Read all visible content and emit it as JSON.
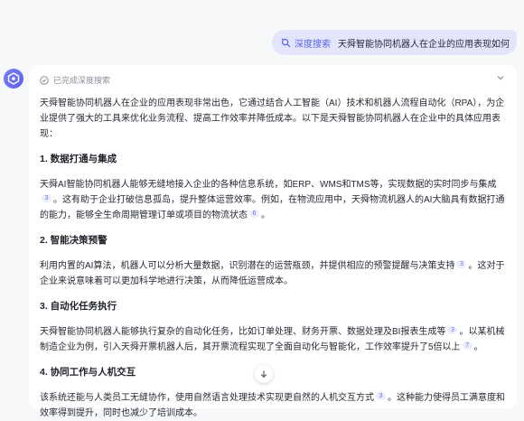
{
  "user_message": {
    "tag_label": "深度搜索",
    "tag_icon": "deep-search-icon",
    "text": "天舜智能协同机器人在企业的应用表现如何"
  },
  "assistant": {
    "status_label": "已完成深度搜索",
    "intro": "天舜智能协同机器人在企业的应用表现非常出色，它通过结合人工智能（AI）技术和机器人流程自动化（RPA），为企业提供了强大的工具来优化业务流程、提高工作效率并降低成本。以下是天舜智能协同机器人在企业中的具体应用表现：",
    "sections": [
      {
        "heading": "1. 数据打通与集成",
        "p1": "天舜AI智能协同机器人能够无缝地接入企业的各种信息系统，如ERP、WMS和TMS等，实现数据的实时同步与集成",
        "cite1": "3",
        "p2": "。这有助于企业打破信息孤岛，提升整体运营效率。例如，在物流应用中，天舜物流机器人的AI大脑具有数据打通的能力，能够全生命周期管理订单或项目的物流状态",
        "cite2": "6",
        "p3": "。"
      },
      {
        "heading": "2. 智能决策预警",
        "p1": "利用内置的AI算法，机器人可以分析大量数据，识别潜在的运营瓶颈，并提供相应的预警提醒与决策支持",
        "cite1": "3",
        "p2": "。这对于企业来说意味着可以更加科学地进行决策，从而降低运营成本。"
      },
      {
        "heading": "3. 自动化任务执行",
        "p1": "天舜智能协同机器人能够执行复杂的自动化任务，比如订单处理、财务开票、数据处理及BI报表生成等",
        "cite1": "3",
        "p2": "。以某机械制造企业为例，引入天舜开票机器人后，其开票流程实现了全面自动化与智能化，工作效率提升了5倍以上",
        "cite2": "7",
        "p3": "。"
      },
      {
        "heading": "4. 协同工作与人机交互",
        "p1": "该系统还能与人类员工无缝协作，使用自然语言处理技术实现更自然的人机交互方式",
        "cite1": "3",
        "p2": "。这种能力使得员工满意度和效率得到提升，同时也减少了培训成本。"
      }
    ]
  },
  "icons": {
    "avatar": "assistant-logo-icon",
    "status": "checkmark-circle-icon",
    "collapse": "chevron-down-icon",
    "scroll": "arrow-down-icon"
  },
  "colors": {
    "accent": "#5b62e8",
    "bubble": "#e3e5fb",
    "background": "#f7f8fa"
  }
}
